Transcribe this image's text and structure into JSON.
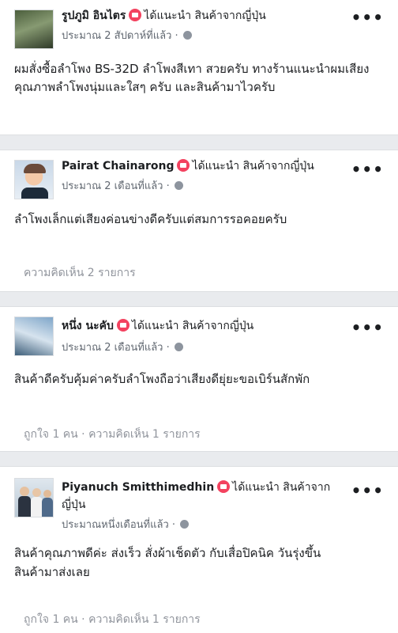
{
  "reviews": [
    {
      "name": "รูปภูมิ อินไตร",
      "recommend_text": "ได้แนะนำ สินค้าจากญี่ปุ่น",
      "time": "ประมาณ 2 สัปดาห์ที่แล้ว ·",
      "text": "ผมสั่งซื้อลำโพง BS-32D ลำโพงสีเทา สวยครับ ทางร้านแนะนำผมเสียงคุณภาพลำโพงนุ่มและใสๆ ครับ และสินค้ามาไวครับ",
      "footer": ""
    },
    {
      "name": "Pairat Chainarong",
      "recommend_text": "ได้แนะนำ สินค้าจากญี่ปุ่น",
      "time": "ประมาณ 2 เดือนที่แล้ว ·",
      "text": "ลำโพงเล็กแต่เสียงค่อนข่างดีครับแต่สมการรอคอยครับ",
      "footer": "ความคิดเห็น 2 รายการ"
    },
    {
      "name": "หนึ่ง นะคับ",
      "recommend_text": "ได้แนะนำ สินค้าจากญี่ปุ่น",
      "time": "ประมาณ 2 เดือนที่แล้ว ·",
      "text": "สินค้าดีครับคุ้มค่าครับลำโพงถือว่าเสียงดียุ่ยะขอเบิร์นสักพัก",
      "footer": "ถูกใจ 1 คน · ความคิดเห็น 1 รายการ"
    },
    {
      "name": "Piyanuch Smitthimedhin",
      "recommend_text_1": "ได้แนะนำ สินค้าจาก",
      "recommend_text_2": "ญี่ปุ่น",
      "time": "ประมาณหนึ่งเดือนที่แล้ว ·",
      "text_1": "สินค้าคุณภาพดีค่ะ ส่งเร็ว สั่งผ้าเช็ดตัว กับเสื่อปิคนิค วันรุ่งขึ้น",
      "text_2": "สินค้ามาส่งเลย",
      "footer": "ถูกใจ 1 คน · ความคิดเห็น 1 รายการ"
    }
  ],
  "more_label": "•••",
  "colors": {
    "recommend": "#f3425f",
    "divider": "#e9ebee",
    "muted": "#90949c"
  }
}
